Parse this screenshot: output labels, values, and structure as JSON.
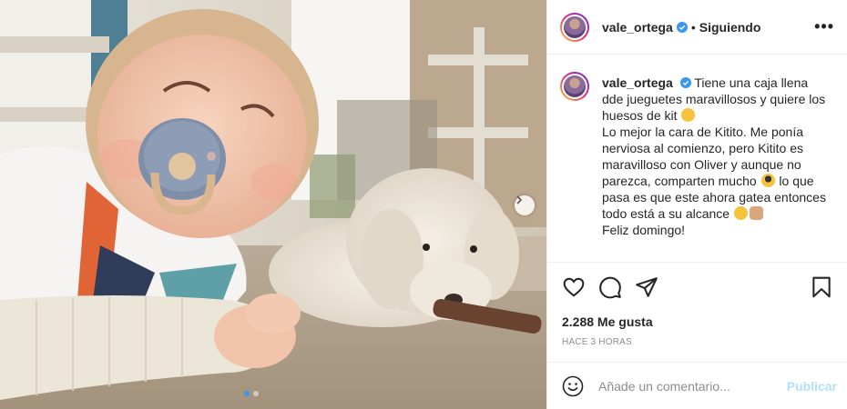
{
  "post": {
    "username": "vale_ortega",
    "follow_separator": "•",
    "follow_status": "Siguiendo",
    "more_options": "•••",
    "caption": {
      "username": "vale_ortega",
      "line1": "Tiene una caja llena dde jueguetes maravillosos y quiere los huesos de kit",
      "line2": "Lo mejor la cara de Kitito. Me ponía nerviosa al comienzo, pero Kitito es maravilloso con Oliver y aunque no parezca, comparten mucho",
      "line2b": "lo que pasa es que este ahora gatea entonces todo está a su alcance",
      "line3": "Feliz domingo!"
    },
    "likes": "2.288 Me gusta",
    "timestamp": "Hace 3 horas",
    "comment": {
      "placeholder": "Añade un comentario...",
      "value": "",
      "publish_label": "Publicar"
    }
  },
  "icons": {
    "verified": "verified-badge-icon",
    "like": "heart-icon",
    "comment": "comment-icon",
    "share": "paper-plane-icon",
    "save": "bookmark-icon",
    "emoji": "smiley-icon",
    "next": "chevron-right-icon"
  },
  "colors": {
    "verified_blue": "#3897f0",
    "text": "#262626",
    "muted": "#8e8e8e",
    "publish_disabled": "#b2dffc"
  }
}
